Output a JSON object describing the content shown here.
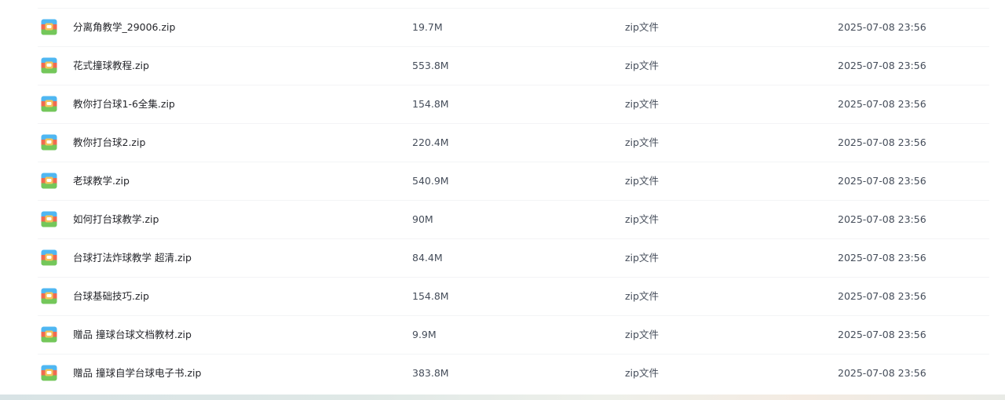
{
  "files": [
    {
      "name": "分离角教学_29006.zip",
      "size": "19.7M",
      "type": "zip文件",
      "modified": "2025-07-08 23:56"
    },
    {
      "name": "花式撞球教程.zip",
      "size": "553.8M",
      "type": "zip文件",
      "modified": "2025-07-08 23:56"
    },
    {
      "name": "教你打台球1-6全集.zip",
      "size": "154.8M",
      "type": "zip文件",
      "modified": "2025-07-08 23:56"
    },
    {
      "name": "教你打台球2.zip",
      "size": "220.4M",
      "type": "zip文件",
      "modified": "2025-07-08 23:56"
    },
    {
      "name": "老球教学.zip",
      "size": "540.9M",
      "type": "zip文件",
      "modified": "2025-07-08 23:56"
    },
    {
      "name": "如何打台球教学.zip",
      "size": "90M",
      "type": "zip文件",
      "modified": "2025-07-08 23:56"
    },
    {
      "name": "台球打法炸球教学 超清.zip",
      "size": "84.4M",
      "type": "zip文件",
      "modified": "2025-07-08 23:56"
    },
    {
      "name": "台球基础技巧.zip",
      "size": "154.8M",
      "type": "zip文件",
      "modified": "2025-07-08 23:56"
    },
    {
      "name": "赠品 撞球台球文档教材.zip",
      "size": "9.9M",
      "type": "zip文件",
      "modified": "2025-07-08 23:56"
    },
    {
      "name": "赠品 撞球自学台球电子书.zip",
      "size": "383.8M",
      "type": "zip文件",
      "modified": "2025-07-08 23:56"
    }
  ],
  "icons": {
    "file": "zip-archive-icon"
  },
  "colors": {
    "zip_top": "#4fb7f2",
    "zip_middle": "#f06a50",
    "zip_bottom": "#74c75a",
    "zip_band": "#f4c35a"
  }
}
